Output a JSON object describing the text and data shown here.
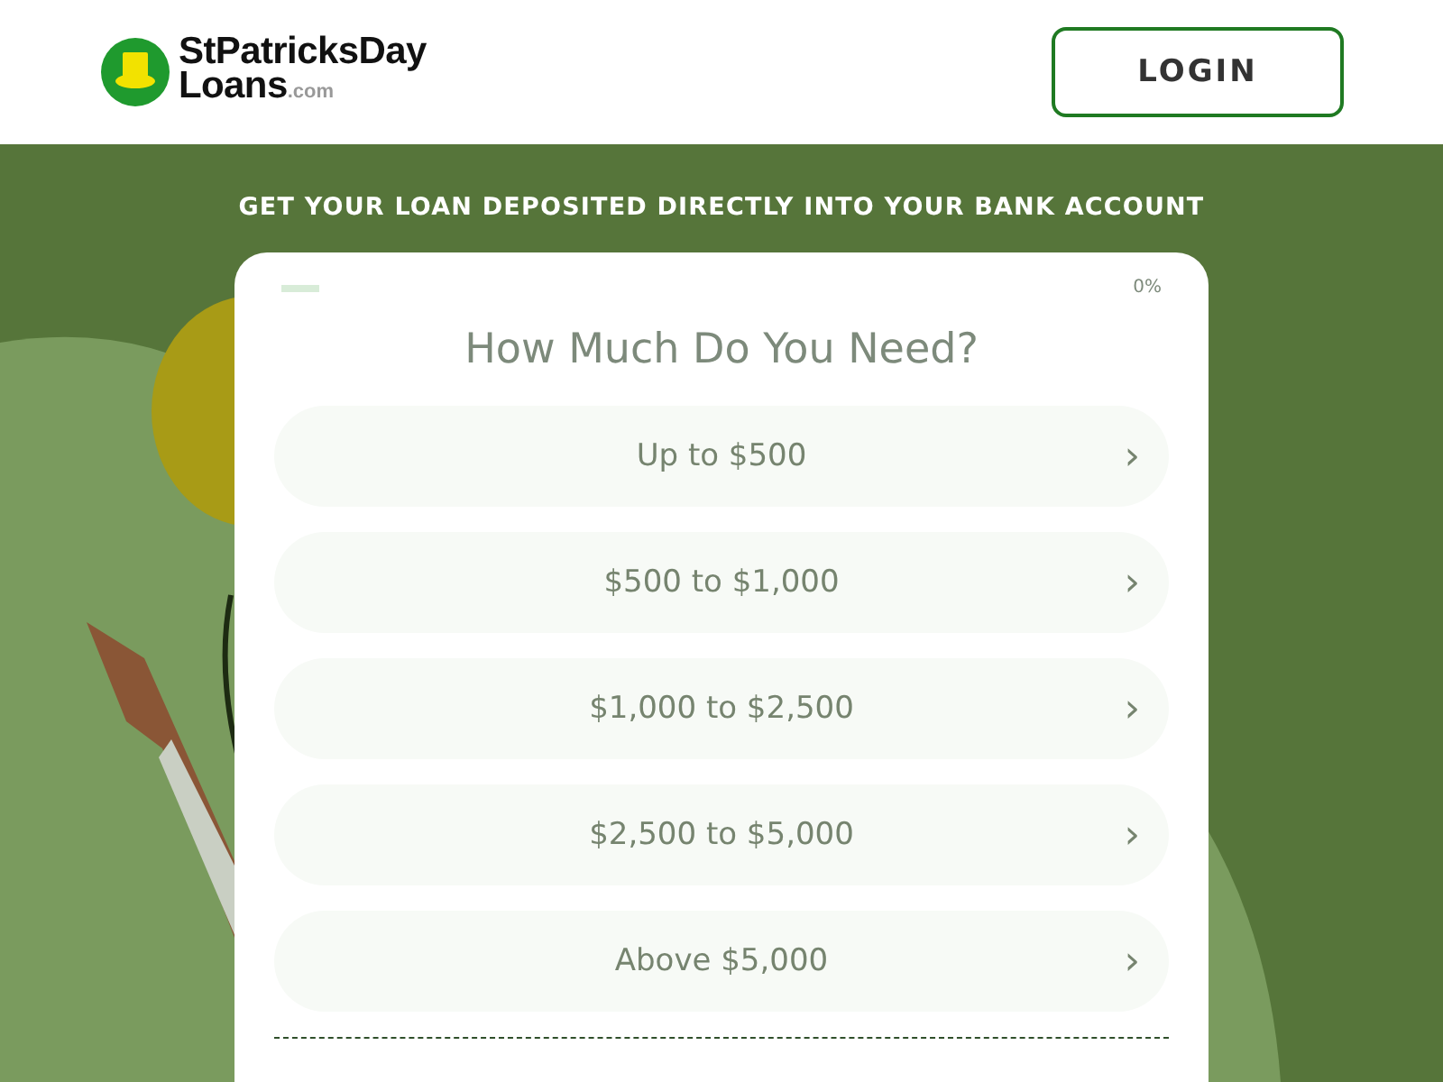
{
  "header": {
    "logo": {
      "line_1": "StPatricksDay",
      "line_2": "Loans",
      "suffix": ".com"
    },
    "login_button": "LOGIN"
  },
  "banner": "GET YOUR LOAN DEPOSITED DIRECTLY INTO YOUR BANK ACCOUNT",
  "form": {
    "progress": {
      "level": 0.05,
      "reading": "0%"
    },
    "question": "How Much Do You Need?",
    "options": [
      {
        "label": "Up to $500",
        "arrow": "›"
      },
      {
        "label": "$500 to $1,000",
        "arrow": "›"
      },
      {
        "label": "$1,000 to $2,500",
        "arrow": "›"
      },
      {
        "label": "$2,500 to $5,000",
        "arrow": "›"
      },
      {
        "label": "Above $5,000",
        "arrow": "›"
      }
    ]
  }
}
